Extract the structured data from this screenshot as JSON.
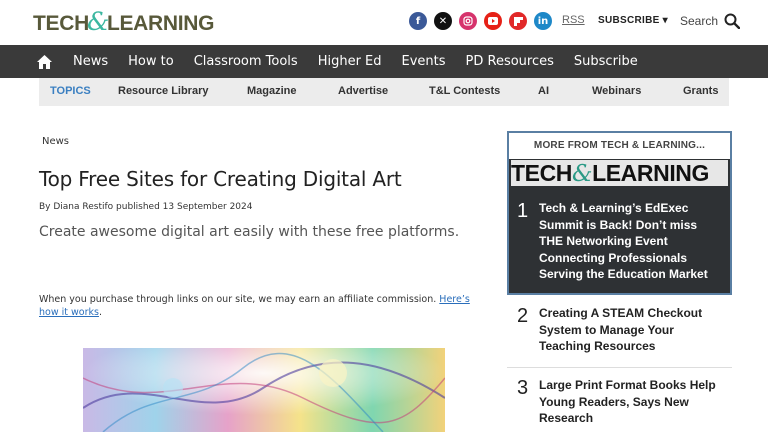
{
  "header": {
    "logo_left": "TECH",
    "logo_amp": "&",
    "logo_right": "LEARNING",
    "social_icons": [
      "facebook-icon",
      "x-icon",
      "instagram-icon",
      "youtube-icon",
      "flipboard-icon",
      "linkedin-icon"
    ],
    "rss": "RSS",
    "subscribe": "SUBSCRIBE ▾",
    "search": "Search"
  },
  "nav": {
    "items": [
      "News",
      "How to",
      "Classroom Tools",
      "Higher Ed",
      "Events",
      "PD Resources",
      "Subscribe"
    ]
  },
  "topics": {
    "label": "TOPICS",
    "items": [
      "Resource Library",
      "Magazine",
      "Advertise",
      "T&L Contests",
      "AI",
      "Webinars",
      "Grants"
    ]
  },
  "article": {
    "breadcrumb": "News",
    "title": "Top Free Sites for Creating Digital Art",
    "byline": "By Diana Restifo published 13 September 2024",
    "subtitle": "Create awesome digital art easily with these free platforms.",
    "affiliate_text": "When you purchase through links on our site, we may earn an affiliate commission.",
    "affiliate_link": "Here’s how it works",
    "affiliate_end": "."
  },
  "sidebar": {
    "heading": "MORE FROM TECH & LEARNING...",
    "logo_left": "TECH",
    "logo_amp": "&",
    "logo_right": "LEARNING",
    "stories": [
      {
        "num": "1",
        "title": "Tech & Learning’s EdExec Summit is Back! Don’t miss THE Networking Event Connecting Professionals Serving the Education Market"
      },
      {
        "num": "2",
        "title": "Creating A STEAM Checkout System to Manage Your Teaching Resources"
      },
      {
        "num": "3",
        "title": "Large Print Format Books Help Young Readers, Says New Research"
      }
    ]
  },
  "colors": {
    "nav_bg": "#3a3a3a",
    "topics_label": "#3a7fc1",
    "logo_text": "#58593a",
    "logo_amp": "#3bb7a0"
  }
}
